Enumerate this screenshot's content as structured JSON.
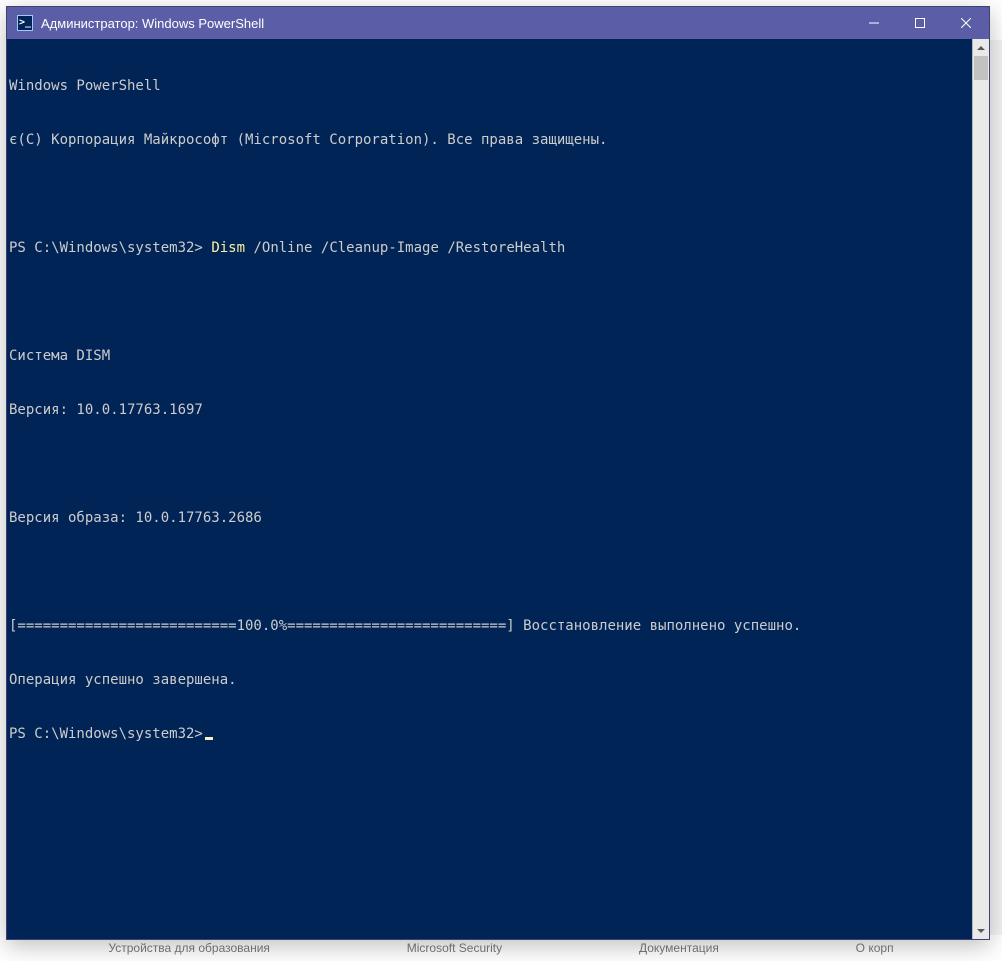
{
  "window": {
    "title": "Администратор: Windows PowerShell",
    "app_icon_glyph": ">_"
  },
  "console": {
    "prompt": "PS C:\\Windows\\system32>",
    "command_highlight": "Dism",
    "command_rest": " /Online /Cleanup-Image /RestoreHealth",
    "lines": {
      "l1": "Windows PowerShell",
      "l2": "є(C) Корпорация Майкрософт (Microsoft Corporation). Все права защищены.",
      "l3": "",
      "l5": "",
      "l6": "Система DISM",
      "l7": "Версия: 10.0.17763.1697",
      "l8": "",
      "l9": "Версия образа: 10.0.17763.2686",
      "l10": "",
      "l11": "[==========================100.0%==========================] Восстановление выполнено успешно.",
      "l12": "Операция успешно завершена."
    }
  },
  "background": {
    "link1": "Устройства для образования",
    "link2": "Microsoft Security",
    "link3": "Документация",
    "link4": "О корп"
  }
}
